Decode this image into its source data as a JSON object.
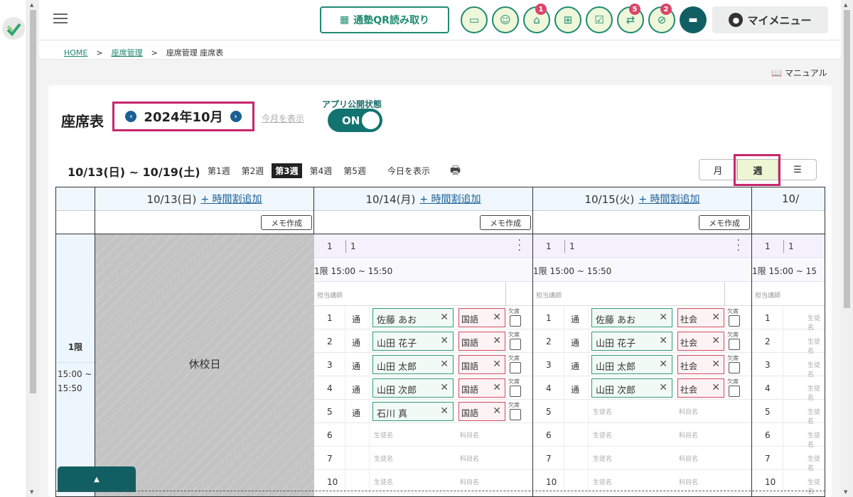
{
  "header": {
    "qr_button": "通塾QR読み取り",
    "icons": [
      {
        "name": "message-icon",
        "badge": ""
      },
      {
        "name": "group-icon",
        "badge": ""
      },
      {
        "name": "school-icon",
        "badge": "1"
      },
      {
        "name": "gift-icon",
        "badge": ""
      },
      {
        "name": "checklist-icon",
        "badge": ""
      },
      {
        "name": "transfer-icon",
        "badge": "5"
      },
      {
        "name": "no-location-icon",
        "badge": "2"
      }
    ],
    "my_menu": "マイメニュー"
  },
  "breadcrumb": {
    "home": "HOME",
    "seat_mgmt": "座席管理",
    "current": "座席管理 座席表",
    "sep": ">"
  },
  "manual": "マニュアル",
  "page": {
    "title": "座席表",
    "month": "2024年10月",
    "this_month": "今月を表示",
    "publish_label": "アプリ公開状態",
    "publish_state": "ON"
  },
  "week": {
    "range": "10/13(日) ~ 10/19(土)",
    "tabs": [
      "第1週",
      "第2週",
      "第3週",
      "第4週",
      "第5週"
    ],
    "active_tab": 2,
    "today": "今日を表示",
    "views": {
      "month": "月",
      "week": "週"
    }
  },
  "grid": {
    "add_timetable": "+ 時間割追加",
    "memo": "メモ作成",
    "days": [
      "10/13(日)",
      "10/14(月)",
      "10/15(火)",
      "10/"
    ],
    "holiday": "休校日",
    "period": "1限",
    "period_time": "15:00 ~ 15:50",
    "room_a": "1",
    "room_b": "1",
    "slot_time": "1限 15:00 ~ 15:50",
    "slot_time_partial": "1限 15:00 ~ 15",
    "teacher_label": "担当講師",
    "student_placeholder": "生徒名",
    "subject_placeholder": "科目名",
    "absent_label": "欠席",
    "commute": "通",
    "seat_numbers": [
      "1",
      "2",
      "3",
      "4",
      "5",
      "6",
      "7",
      "10"
    ],
    "col_mon": [
      {
        "student": "佐藤 あお",
        "subject": "国語"
      },
      {
        "student": "山田 花子",
        "subject": "国語"
      },
      {
        "student": "山田 太郎",
        "subject": "国語"
      },
      {
        "student": "山田 次郎",
        "subject": "国語"
      },
      {
        "student": "石川 真",
        "subject": "国語"
      }
    ],
    "col_tue": [
      {
        "student": "佐藤 あお",
        "subject": "社会"
      },
      {
        "student": "山田 花子",
        "subject": "社会"
      },
      {
        "student": "山田 太郎",
        "subject": "社会"
      },
      {
        "student": "山田 次郎",
        "subject": "社会"
      }
    ]
  },
  "colors": {
    "accent": "#1f8a70",
    "highlight": "#c8266d",
    "dark_teal": "#125f63",
    "badge": "#d9466a"
  }
}
